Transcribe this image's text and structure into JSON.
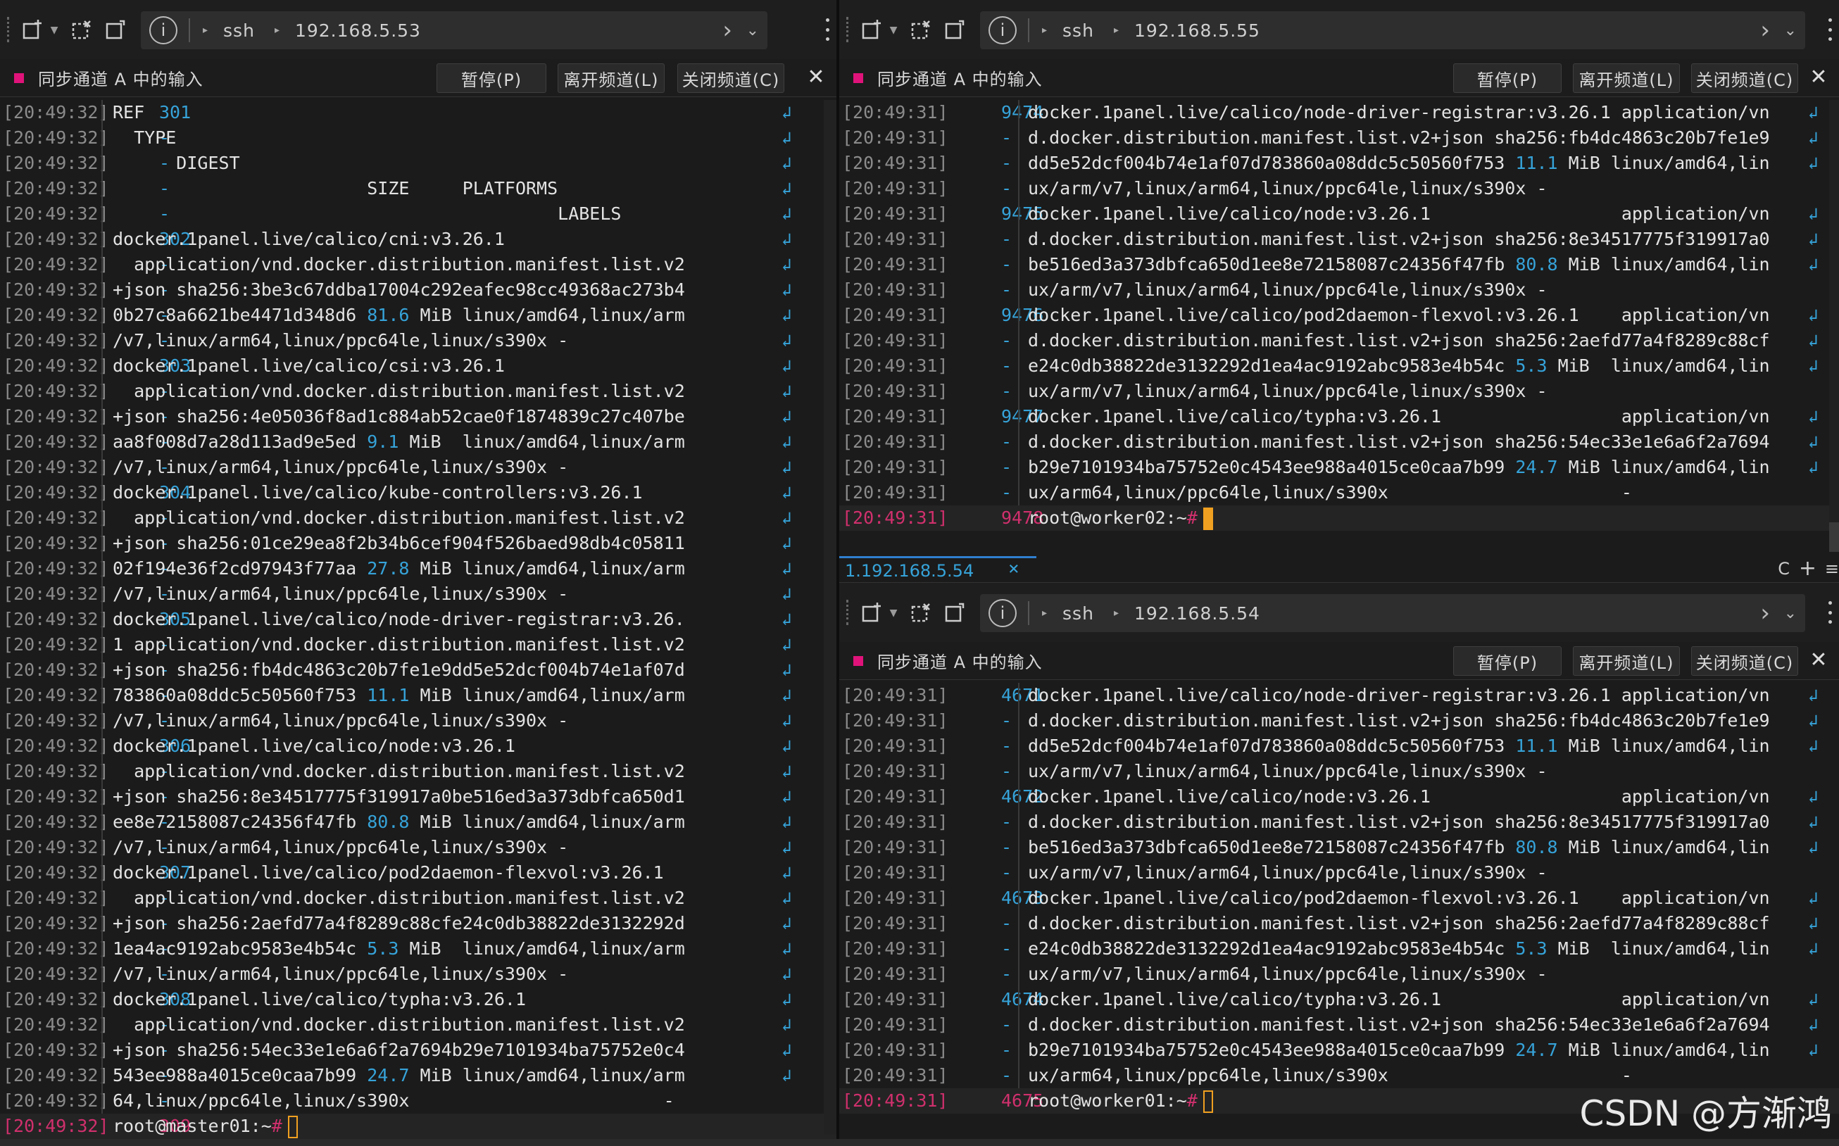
{
  "left": {
    "breadcrumb": [
      "ssh",
      "192.168.5.53"
    ],
    "sync_label": "同步通道 A 中的输入",
    "buttons": {
      "pause": "暂停(P)",
      "leave": "离开频道(L)",
      "close": "关闭频道(C)"
    },
    "lines": [
      {
        "ts": "[20:49:32]",
        "num": "301",
        "text": "REF"
      },
      {
        "ts": "[20:49:32]",
        "num": "-",
        "text": "  TYPE"
      },
      {
        "ts": "[20:49:32]",
        "num": "-",
        "text": "      DIGEST"
      },
      {
        "ts": "[20:49:32]",
        "num": "-",
        "text": "                        SIZE     PLATFORMS"
      },
      {
        "ts": "[20:49:32]",
        "num": "-",
        "text": "                                          LABELS"
      },
      {
        "ts": "[20:49:32]",
        "num": "302",
        "text": "docker.1panel.live/calico/cni:v3.26.1"
      },
      {
        "ts": "[20:49:32]",
        "num": "-",
        "text": "  application/vnd.docker.distribution.manifest.list.v2"
      },
      {
        "ts": "[20:49:32]",
        "num": "-",
        "text": "+json sha256:3be3c67ddba17004c292eafec98cc49368ac273b4"
      },
      {
        "ts": "[20:49:32]",
        "num": "-",
        "text": "0b27c8a6621be4471d348d6 ",
        "size": "81.6",
        "rest": " MiB linux/amd64,linux/arm"
      },
      {
        "ts": "[20:49:32]",
        "num": "-",
        "text": "/v7,linux/arm64,linux/ppc64le,linux/s390x -"
      },
      {
        "ts": "[20:49:32]",
        "num": "303",
        "text": "docker.1panel.live/calico/csi:v3.26.1"
      },
      {
        "ts": "[20:49:32]",
        "num": "-",
        "text": "  application/vnd.docker.distribution.manifest.list.v2"
      },
      {
        "ts": "[20:49:32]",
        "num": "-",
        "text": "+json sha256:4e05036f8ad1c884ab52cae0f1874839c27c407be"
      },
      {
        "ts": "[20:49:32]",
        "num": "-",
        "text": "aa8f008d7a28d113ad9e5ed ",
        "size": "9.1",
        "rest": " MiB  linux/amd64,linux/arm"
      },
      {
        "ts": "[20:49:32]",
        "num": "-",
        "text": "/v7,linux/arm64,linux/ppc64le,linux/s390x -"
      },
      {
        "ts": "[20:49:32]",
        "num": "304",
        "text": "docker.1panel.live/calico/kube-controllers:v3.26.1"
      },
      {
        "ts": "[20:49:32]",
        "num": "-",
        "text": "  application/vnd.docker.distribution.manifest.list.v2"
      },
      {
        "ts": "[20:49:32]",
        "num": "-",
        "text": "+json sha256:01ce29ea8f2b34b6cef904f526baed98db4c05811"
      },
      {
        "ts": "[20:49:32]",
        "num": "-",
        "text": "02f194e36f2cd97943f77aa ",
        "size": "27.8",
        "rest": " MiB linux/amd64,linux/arm"
      },
      {
        "ts": "[20:49:32]",
        "num": "-",
        "text": "/v7,linux/arm64,linux/ppc64le,linux/s390x -"
      },
      {
        "ts": "[20:49:32]",
        "num": "305",
        "text": "docker.1panel.live/calico/node-driver-registrar:v3.26."
      },
      {
        "ts": "[20:49:32]",
        "num": "-",
        "text": "1 application/vnd.docker.distribution.manifest.list.v2"
      },
      {
        "ts": "[20:49:32]",
        "num": "-",
        "text": "+json sha256:fb4dc4863c20b7fe1e9dd5e52dcf004b74e1af07d"
      },
      {
        "ts": "[20:49:32]",
        "num": "-",
        "text": "783860a08ddc5c50560f753 ",
        "size": "11.1",
        "rest": " MiB linux/amd64,linux/arm"
      },
      {
        "ts": "[20:49:32]",
        "num": "-",
        "text": "/v7,linux/arm64,linux/ppc64le,linux/s390x -"
      },
      {
        "ts": "[20:49:32]",
        "num": "306",
        "text": "docker.1panel.live/calico/node:v3.26.1"
      },
      {
        "ts": "[20:49:32]",
        "num": "-",
        "text": "  application/vnd.docker.distribution.manifest.list.v2"
      },
      {
        "ts": "[20:49:32]",
        "num": "-",
        "text": "+json sha256:8e34517775f319917a0be516ed3a373dbfca650d1"
      },
      {
        "ts": "[20:49:32]",
        "num": "-",
        "text": "ee8e72158087c24356f47fb ",
        "size": "80.8",
        "rest": " MiB linux/amd64,linux/arm"
      },
      {
        "ts": "[20:49:32]",
        "num": "-",
        "text": "/v7,linux/arm64,linux/ppc64le,linux/s390x -"
      },
      {
        "ts": "[20:49:32]",
        "num": "307",
        "text": "docker.1panel.live/calico/pod2daemon-flexvol:v3.26.1"
      },
      {
        "ts": "[20:49:32]",
        "num": "-",
        "text": "  application/vnd.docker.distribution.manifest.list.v2"
      },
      {
        "ts": "[20:49:32]",
        "num": "-",
        "text": "+json sha256:2aefd77a4f8289c88cfe24c0db38822de3132292d"
      },
      {
        "ts": "[20:49:32]",
        "num": "-",
        "text": "1ea4ac9192abc9583e4b54c ",
        "size": "5.3",
        "rest": " MiB  linux/amd64,linux/arm"
      },
      {
        "ts": "[20:49:32]",
        "num": "-",
        "text": "/v7,linux/arm64,linux/ppc64le,linux/s390x -"
      },
      {
        "ts": "[20:49:32]",
        "num": "308",
        "text": "docker.1panel.live/calico/typha:v3.26.1"
      },
      {
        "ts": "[20:49:32]",
        "num": "-",
        "text": "  application/vnd.docker.distribution.manifest.list.v2"
      },
      {
        "ts": "[20:49:32]",
        "num": "-",
        "text": "+json sha256:54ec33e1e6a6f2a7694b29e7101934ba75752e0c4"
      },
      {
        "ts": "[20:49:32]",
        "num": "-",
        "text": "543ee988a4015ce0caa7b99 ",
        "size": "24.7",
        "rest": " MiB linux/amd64,linux/arm"
      },
      {
        "ts": "[20:49:32]",
        "num": "-",
        "text": "64,linux/ppc64le,linux/s390x                        -",
        "nowrap": true
      }
    ],
    "prompt": {
      "ts": "[20:49:32]",
      "num": "309",
      "text": "root@master01:~# "
    }
  },
  "right_top": {
    "breadcrumb": [
      "ssh",
      "192.168.5.55"
    ],
    "sync_label": "同步通道 A 中的输入",
    "buttons": {
      "pause": "暂停(P)",
      "leave": "离开频道(L)",
      "close": "关闭频道(C)"
    },
    "lines": [
      {
        "ts": "[20:49:31]",
        "num": "9474",
        "text": "docker.1panel.live/calico/node-driver-registrar:v3.26.1 application/vn"
      },
      {
        "ts": "[20:49:31]",
        "num": "-",
        "text": "d.docker.distribution.manifest.list.v2+json sha256:fb4dc4863c20b7fe1e9"
      },
      {
        "ts": "[20:49:31]",
        "num": "-",
        "text": "dd5e52dcf004b74e1af07d783860a08ddc5c50560f753 ",
        "size": "11.1",
        "rest": " MiB linux/amd64,lin"
      },
      {
        "ts": "[20:49:31]",
        "num": "-",
        "text": "ux/arm/v7,linux/arm64,linux/ppc64le,linux/s390x -",
        "nowrap": true
      },
      {
        "ts": "[20:49:31]",
        "num": "9475",
        "text": "docker.1panel.live/calico/node:v3.26.1                  application/vn"
      },
      {
        "ts": "[20:49:31]",
        "num": "-",
        "text": "d.docker.distribution.manifest.list.v2+json sha256:8e34517775f319917a0"
      },
      {
        "ts": "[20:49:31]",
        "num": "-",
        "text": "be516ed3a373dbfca650d1ee8e72158087c24356f47fb ",
        "size": "80.8",
        "rest": " MiB linux/amd64,lin"
      },
      {
        "ts": "[20:49:31]",
        "num": "-",
        "text": "ux/arm/v7,linux/arm64,linux/ppc64le,linux/s390x -",
        "nowrap": true
      },
      {
        "ts": "[20:49:31]",
        "num": "9476",
        "text": "docker.1panel.live/calico/pod2daemon-flexvol:v3.26.1    application/vn"
      },
      {
        "ts": "[20:49:31]",
        "num": "-",
        "text": "d.docker.distribution.manifest.list.v2+json sha256:2aefd77a4f8289c88cf"
      },
      {
        "ts": "[20:49:31]",
        "num": "-",
        "text": "e24c0db38822de3132292d1ea4ac9192abc9583e4b54c ",
        "size": "5.3",
        "rest": " MiB  linux/amd64,lin"
      },
      {
        "ts": "[20:49:31]",
        "num": "-",
        "text": "ux/arm/v7,linux/arm64,linux/ppc64le,linux/s390x -",
        "nowrap": true
      },
      {
        "ts": "[20:49:31]",
        "num": "9477",
        "text": "docker.1panel.live/calico/typha:v3.26.1                 application/vn"
      },
      {
        "ts": "[20:49:31]",
        "num": "-",
        "text": "d.docker.distribution.manifest.list.v2+json sha256:54ec33e1e6a6f2a7694"
      },
      {
        "ts": "[20:49:31]",
        "num": "-",
        "text": "b29e7101934ba75752e0c4543ee988a4015ce0caa7b99 ",
        "size": "24.7",
        "rest": " MiB linux/amd64,lin"
      },
      {
        "ts": "[20:49:31]",
        "num": "-",
        "text": "ux/arm64,linux/ppc64le,linux/s390x                      -",
        "nowrap": true
      }
    ],
    "prompt": {
      "ts": "[20:49:31]",
      "num": "9478",
      "text": "root@worker02:~# "
    }
  },
  "right_bottom": {
    "tab": {
      "label": "1.192.168.5.54",
      "close": "×"
    },
    "tab_tools": {
      "c": "C",
      "plus": "+",
      "menu": "≡"
    },
    "breadcrumb": [
      "ssh",
      "192.168.5.54"
    ],
    "sync_label": "同步通道 A 中的输入",
    "buttons": {
      "pause": "暂停(P)",
      "leave": "离开频道(L)",
      "close": "关闭频道(C)"
    },
    "lines": [
      {
        "ts": "[20:49:31]",
        "num": "4671",
        "text": "docker.1panel.live/calico/node-driver-registrar:v3.26.1 application/vn"
      },
      {
        "ts": "[20:49:31]",
        "num": "-",
        "text": "d.docker.distribution.manifest.list.v2+json sha256:fb4dc4863c20b7fe1e9"
      },
      {
        "ts": "[20:49:31]",
        "num": "-",
        "text": "dd5e52dcf004b74e1af07d783860a08ddc5c50560f753 ",
        "size": "11.1",
        "rest": " MiB linux/amd64,lin"
      },
      {
        "ts": "[20:49:31]",
        "num": "-",
        "text": "ux/arm/v7,linux/arm64,linux/ppc64le,linux/s390x -",
        "nowrap": true
      },
      {
        "ts": "[20:49:31]",
        "num": "4672",
        "text": "docker.1panel.live/calico/node:v3.26.1                  application/vn"
      },
      {
        "ts": "[20:49:31]",
        "num": "-",
        "text": "d.docker.distribution.manifest.list.v2+json sha256:8e34517775f319917a0"
      },
      {
        "ts": "[20:49:31]",
        "num": "-",
        "text": "be516ed3a373dbfca650d1ee8e72158087c24356f47fb ",
        "size": "80.8",
        "rest": " MiB linux/amd64,lin"
      },
      {
        "ts": "[20:49:31]",
        "num": "-",
        "text": "ux/arm/v7,linux/arm64,linux/ppc64le,linux/s390x -",
        "nowrap": true
      },
      {
        "ts": "[20:49:31]",
        "num": "4673",
        "text": "docker.1panel.live/calico/pod2daemon-flexvol:v3.26.1    application/vn"
      },
      {
        "ts": "[20:49:31]",
        "num": "-",
        "text": "d.docker.distribution.manifest.list.v2+json sha256:2aefd77a4f8289c88cf"
      },
      {
        "ts": "[20:49:31]",
        "num": "-",
        "text": "e24c0db38822de3132292d1ea4ac9192abc9583e4b54c ",
        "size": "5.3",
        "rest": " MiB  linux/amd64,lin"
      },
      {
        "ts": "[20:49:31]",
        "num": "-",
        "text": "ux/arm/v7,linux/arm64,linux/ppc64le,linux/s390x -",
        "nowrap": true
      },
      {
        "ts": "[20:49:31]",
        "num": "4674",
        "text": "docker.1panel.live/calico/typha:v3.26.1                 application/vn"
      },
      {
        "ts": "[20:49:31]",
        "num": "-",
        "text": "d.docker.distribution.manifest.list.v2+json sha256:54ec33e1e6a6f2a7694"
      },
      {
        "ts": "[20:49:31]",
        "num": "-",
        "text": "b29e7101934ba75752e0c4543ee988a4015ce0caa7b99 ",
        "size": "24.7",
        "rest": " MiB linux/amd64,lin"
      },
      {
        "ts": "[20:49:31]",
        "num": "-",
        "text": "ux/arm64,linux/ppc64le,linux/s390x                      -",
        "nowrap": true
      }
    ],
    "prompt": {
      "ts": "[20:49:31]",
      "num": "4675",
      "text": "root@worker01:~# "
    }
  },
  "watermark": "CSDN @方渐鸿",
  "colors": {
    "accent": "#36a3d9",
    "sync_dot": "#e0137a",
    "cursor": "#f0a020",
    "prompt_ts": "#d0306d"
  }
}
